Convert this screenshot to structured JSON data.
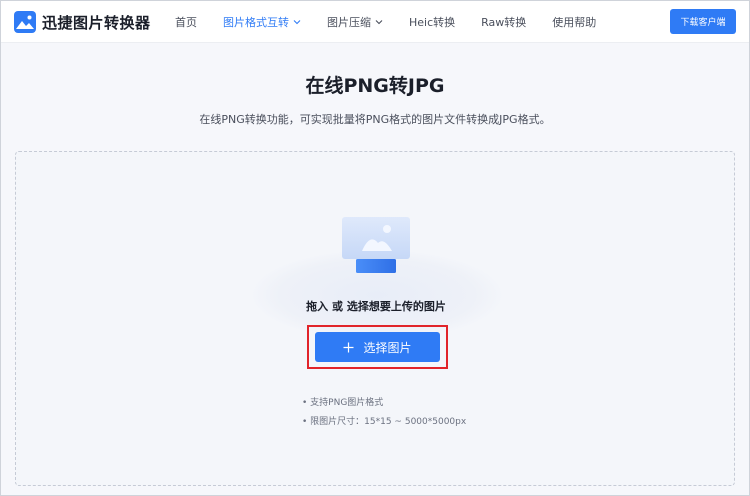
{
  "header": {
    "logo_text": "迅捷图片转换器",
    "nav": [
      {
        "label": "首页",
        "has_dropdown": false,
        "active": false
      },
      {
        "label": "图片格式互转",
        "has_dropdown": true,
        "active": true
      },
      {
        "label": "图片压缩",
        "has_dropdown": true,
        "active": false
      },
      {
        "label": "Heic转换",
        "has_dropdown": false,
        "active": false
      },
      {
        "label": "Raw转换",
        "has_dropdown": false,
        "active": false
      },
      {
        "label": "使用帮助",
        "has_dropdown": false,
        "active": false
      }
    ],
    "download_label": "下载客户端"
  },
  "main": {
    "title": "在线PNG转JPG",
    "description": "在线PNG转换功能，可实现批量将PNG格式的图片文件转换成JPG格式。",
    "dropzone": {
      "hint": "拖入 或 选择想要上传的图片",
      "select_label": "选择图片",
      "notes": [
        "• 支持PNG图片格式",
        "• 限图片尺寸：15*15 ~ 5000*5000px"
      ]
    }
  },
  "colors": {
    "accent": "#2f7bf5",
    "highlight_border": "#e1242a",
    "page_background": "#f6f7fb"
  },
  "icons": {
    "logo": "image-icon",
    "nav_dropdown": "chevron-down-icon",
    "select": "plus-icon",
    "upload_illustration": "monitor-image-icon"
  }
}
